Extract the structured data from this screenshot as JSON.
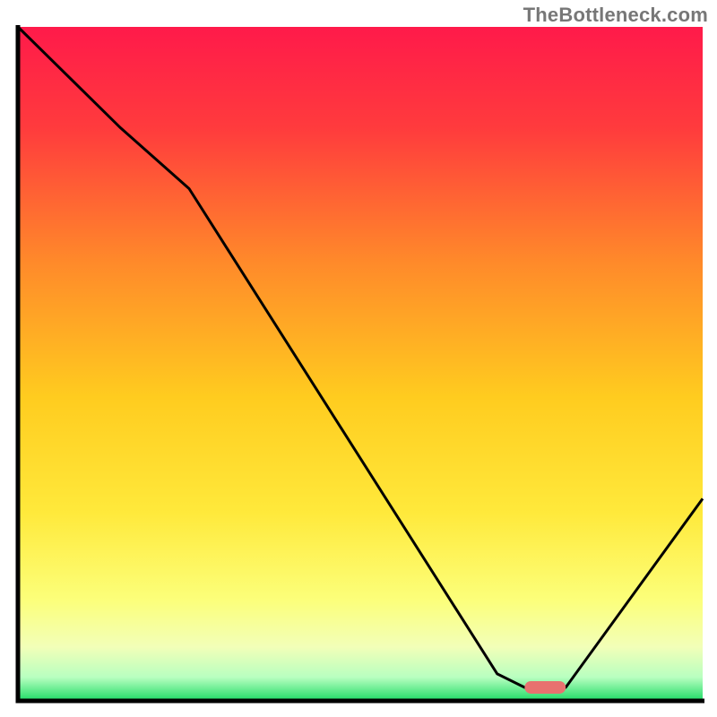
{
  "watermark": "TheBottleneck.com",
  "chart_data": {
    "type": "line",
    "title": "",
    "xlabel": "",
    "ylabel": "",
    "xlim": [
      0,
      100
    ],
    "ylim": [
      0,
      100
    ],
    "series": [
      {
        "name": "curve",
        "x": [
          0,
          15,
          25,
          70,
          74,
          80,
          100
        ],
        "y": [
          100,
          85,
          76,
          4,
          2,
          2,
          30
        ]
      }
    ],
    "marker": {
      "x_start": 74,
      "x_end": 80,
      "y": 2,
      "color": "#e8716f"
    },
    "gradient_stops": [
      {
        "offset": 0.0,
        "color": "#ff1a4a"
      },
      {
        "offset": 0.15,
        "color": "#ff3b3d"
      },
      {
        "offset": 0.35,
        "color": "#ff8a2a"
      },
      {
        "offset": 0.55,
        "color": "#ffcc1f"
      },
      {
        "offset": 0.72,
        "color": "#ffe93b"
      },
      {
        "offset": 0.85,
        "color": "#fcff7a"
      },
      {
        "offset": 0.92,
        "color": "#f2ffb8"
      },
      {
        "offset": 0.965,
        "color": "#b8ffc0"
      },
      {
        "offset": 1.0,
        "color": "#1edb66"
      }
    ],
    "axis_color": "#000000",
    "curve_color": "#000000",
    "curve_width": 3
  }
}
